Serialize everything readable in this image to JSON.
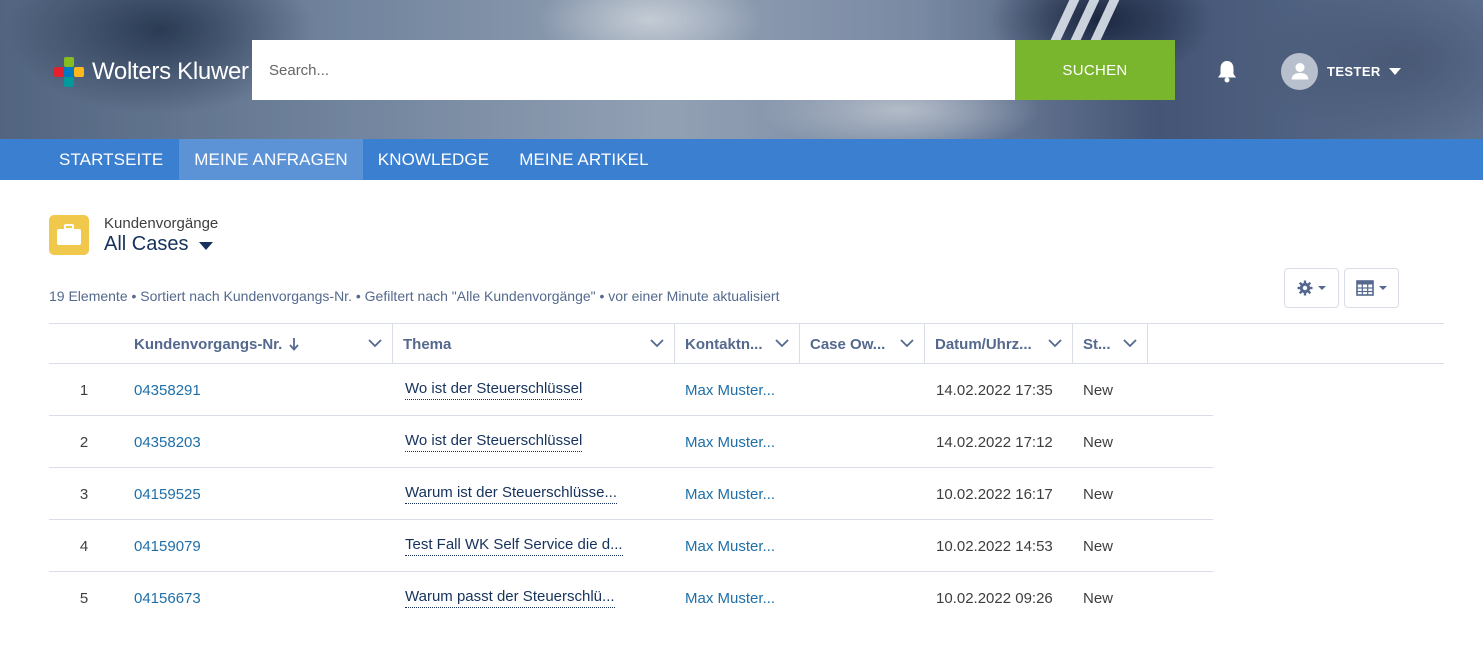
{
  "brand": {
    "name": "Wolters Kluwer"
  },
  "search": {
    "placeholder": "Search...",
    "button_label": "SUCHEN"
  },
  "user": {
    "name": "TESTER"
  },
  "nav": {
    "items": [
      {
        "label": "STARTSEITE",
        "active": false
      },
      {
        "label": "MEINE ANFRAGEN",
        "active": true
      },
      {
        "label": "KNOWLEDGE",
        "active": false
      },
      {
        "label": "MEINE ARTIKEL",
        "active": false
      }
    ]
  },
  "list": {
    "object_label": "Kundenvorgänge",
    "view_name": "All Cases",
    "meta": "19 Elemente • Sortiert nach Kundenvorgangs-Nr. • Gefiltert nach \"Alle Kundenvorgänge\" • vor einer Minute aktualisiert"
  },
  "table": {
    "columns": [
      "Kundenvorgangs-Nr.",
      "Thema",
      "Kontaktn...",
      "Case Ow...",
      "Datum/Uhrz...",
      "St..."
    ],
    "rows": [
      {
        "index": "1",
        "case_number": "04358291",
        "subject": "Wo ist der Steuerschlüssel",
        "contact": "Max Muster...",
        "owner": "",
        "date": "14.02.2022 17:35",
        "status": "New"
      },
      {
        "index": "2",
        "case_number": "04358203",
        "subject": "Wo ist der Steuerschlüssel",
        "contact": "Max Muster...",
        "owner": "",
        "date": "14.02.2022 17:12",
        "status": "New"
      },
      {
        "index": "3",
        "case_number": "04159525",
        "subject": "Warum ist der Steuerschlüsse...",
        "contact": "Max Muster...",
        "owner": "",
        "date": "10.02.2022 16:17",
        "status": "New"
      },
      {
        "index": "4",
        "case_number": "04159079",
        "subject": "Test Fall WK Self Service die d...",
        "contact": "Max Muster...",
        "owner": "",
        "date": "10.02.2022 14:53",
        "status": "New"
      },
      {
        "index": "5",
        "case_number": "04156673",
        "subject": "Warum passt der Steuerschlü...",
        "contact": "Max Muster...",
        "owner": "",
        "date": "10.02.2022 09:26",
        "status": "New"
      }
    ]
  },
  "colors": {
    "search_button": "#79b62e",
    "nav_bar": "#3b7fd0",
    "nav_active": "#5b93d6",
    "link": "#1e6fa8",
    "object_icon": "#f0c94c"
  },
  "icons": {
    "bell": "bell-icon",
    "avatar": "user-avatar-icon",
    "object": "briefcase-icon",
    "settings": "gear-icon",
    "display": "table-icon",
    "sort": "arrow-down-icon",
    "column_menu": "chevron-down-icon"
  }
}
